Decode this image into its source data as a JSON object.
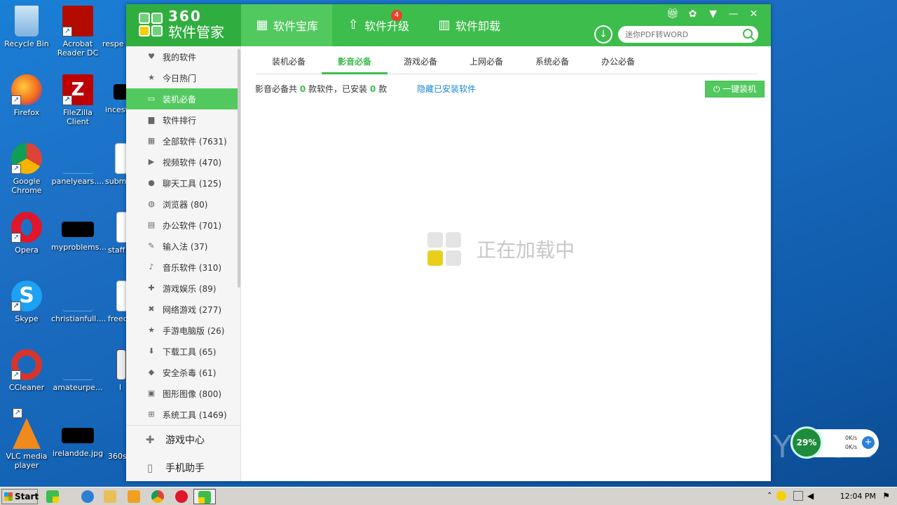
{
  "desktop": {
    "icons": [
      {
        "label": "Recycle Bin"
      },
      {
        "label": "Acrobat Reader DC"
      },
      {
        "label": "respe"
      },
      {
        "label": "Firefox"
      },
      {
        "label": "FileZilla Client"
      },
      {
        "label": "incest"
      },
      {
        "label": "Google Chrome"
      },
      {
        "label": "panelyears...."
      },
      {
        "label": "submi"
      },
      {
        "label": "Opera"
      },
      {
        "label": "myproblems..."
      },
      {
        "label": "staff"
      },
      {
        "label": "Skype"
      },
      {
        "label": "christianfull...."
      },
      {
        "label": "freed"
      },
      {
        "label": "CCleaner"
      },
      {
        "label": "amateurpe..."
      },
      {
        "label": "l"
      },
      {
        "label": "VLC media player"
      },
      {
        "label": "irelandde.jpg"
      },
      {
        "label": "360s"
      }
    ]
  },
  "app": {
    "logo_top": "360",
    "logo_bottom": "软件管家",
    "nav": [
      {
        "label": "软件宝库",
        "icon": "grid-icon"
      },
      {
        "label": "软件升级",
        "icon": "upgrade-icon",
        "badge": "4"
      },
      {
        "label": "软件卸载",
        "icon": "trash-icon"
      }
    ],
    "search": {
      "placeholder": "迷你PDF转WORD"
    },
    "sidebar": {
      "items": [
        {
          "label": "我的软件",
          "icon": "heart-icon"
        },
        {
          "label": "今日热门",
          "icon": "star-icon"
        },
        {
          "label": "装机必备",
          "icon": "monitor-icon"
        },
        {
          "label": "软件排行",
          "icon": "bars-icon"
        },
        {
          "label": "全部软件 (7631)",
          "icon": "grid-icon"
        },
        {
          "label": "视频软件 (470)",
          "icon": "play-icon"
        },
        {
          "label": "聊天工具 (125)",
          "icon": "chat-icon"
        },
        {
          "label": "浏览器 (80)",
          "icon": "globe-icon"
        },
        {
          "label": "办公软件 (701)",
          "icon": "printer-icon"
        },
        {
          "label": "输入法 (37)",
          "icon": "pen-icon"
        },
        {
          "label": "音乐软件 (310)",
          "icon": "music-icon"
        },
        {
          "label": "游戏娱乐 (89)",
          "icon": "gamepad-icon"
        },
        {
          "label": "网络游戏 (277)",
          "icon": "tools-icon"
        },
        {
          "label": "手游电脑版 (26)",
          "icon": "star-icon"
        },
        {
          "label": "下载工具 (65)",
          "icon": "download-icon"
        },
        {
          "label": "安全杀毒 (61)",
          "icon": "shield-icon"
        },
        {
          "label": "图形图像 (800)",
          "icon": "image-icon"
        },
        {
          "label": "系统工具 (1469)",
          "icon": "windows-icon"
        }
      ],
      "bottom": [
        {
          "label": "游戏中心",
          "icon": "gamepad-icon"
        },
        {
          "label": "手机助手",
          "icon": "phone-icon"
        }
      ]
    },
    "tabs": [
      "装机必备",
      "影音必备",
      "游戏必备",
      "上网必备",
      "系统必备",
      "办公必备"
    ],
    "info": {
      "prefix": "影音必备共",
      "count": "0",
      "middle": "款软件，已安装",
      "installed": "0",
      "suffix": "款"
    },
    "hide_link": "隐藏已安装软件",
    "install_button": "一键装机",
    "loading_text": "正在加载中"
  },
  "taskbar": {
    "start_label": "Start",
    "clock": "12:04 PM"
  },
  "speed_widget": {
    "percent": "29%",
    "up": "0K/s",
    "down": "0K/s"
  },
  "watermark": "ANY RUN",
  "colors": {
    "accent_green": "#3dbd4c",
    "active_green": "#52c95f",
    "link_blue": "#1a87d8",
    "badge_red": "#e8412c"
  }
}
